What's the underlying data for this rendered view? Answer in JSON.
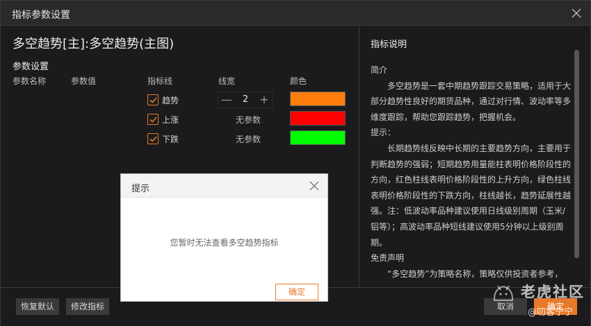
{
  "window": {
    "title": "指标参数设置"
  },
  "indicator": {
    "name": "多空趋势[主]:多空趋势(主图)"
  },
  "params": {
    "section_title": "参数设置",
    "headers": {
      "name": "参数名称",
      "value": "参数值",
      "line": "指标线",
      "width": "线宽",
      "color": "颜色"
    },
    "lines": [
      {
        "label": "趋势",
        "checked": true,
        "width": "2",
        "color": "#ff7f0e"
      },
      {
        "label": "上涨",
        "checked": true,
        "width_text": "无参数",
        "color": "#ff0000"
      },
      {
        "label": "下跌",
        "checked": true,
        "width_text": "无参数",
        "color": "#00ff00"
      }
    ]
  },
  "help": {
    "title": "指标说明",
    "intro_heading": "简介",
    "intro": "多空趋势是一套中期趋势跟踪交易策略，适用于大部分趋势性良好的期货品种，通过对行情、波动率等多维度跟踪，帮助您跟踪趋势，把握机会。",
    "tip_heading": "提示：",
    "tip": "长期趋势线反映中长期的主要趋势方向，主要用于判断趋势的强弱；短期趋势用量能柱表明价格阶段性的方向，红色柱线表明价格阶段性的上升方向，绿色柱线表明价格阶段性的下跌方向，柱线越长，趋势延展性越强。注：低波动率品种建议使用日线级别周期（玉米/铝等）；高波动率品种短线建议使用5分钟以上级别周期。",
    "disclaimer_heading": "免责声明",
    "disclaimer": "“多空趋势”为策略名称，策略仅供投资者参考，"
  },
  "footer": {
    "restore_label": "恢复默认",
    "modify_label": "修改指标",
    "cancel_label": "取消",
    "confirm_label": "确定"
  },
  "modal": {
    "title": "提示",
    "message": "您暂时无法查看多空趋势指标",
    "ok_label": "确定"
  },
  "watermark": {
    "brand": "老虎社区",
    "user": "@叨客宁宁"
  },
  "colors": {
    "accent": "#e87a2c"
  }
}
